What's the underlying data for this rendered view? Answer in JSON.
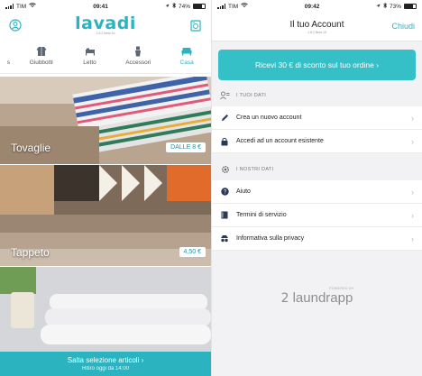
{
  "left": {
    "status": {
      "carrier": "TIM",
      "time": "09:41",
      "battery": "74%"
    },
    "header": {
      "logo_text": "lavadi",
      "logo_sub": "1.8.2 Beta 16",
      "profile_icon": "profile-icon",
      "basket_icon": "basket-icon"
    },
    "categories": [
      {
        "label": "s",
        "icon": "category-icon",
        "partial": true
      },
      {
        "label": "Giubbotti",
        "icon": "jacket-icon"
      },
      {
        "label": "Letto",
        "icon": "bed-icon"
      },
      {
        "label": "Accessori",
        "icon": "accessories-icon"
      },
      {
        "label": "Casa",
        "icon": "sofa-icon",
        "active": true
      }
    ],
    "tiles": [
      {
        "label": "Tovaglie",
        "price": "DALLE 8 €"
      },
      {
        "label": "Tappeto",
        "price": "4,50 €"
      },
      {
        "label": ""
      }
    ],
    "cta": {
      "label": "Salta selezione articoli ›",
      "sub": "Ritiro oggi da 14:00"
    },
    "colors": {
      "accent": "#2bb3c0"
    }
  },
  "right": {
    "status": {
      "carrier": "TIM",
      "time": "09:42",
      "battery": "73%"
    },
    "nav": {
      "title": "Il tuo Account",
      "subtitle": "1.8.2 Beta 16",
      "close": "Chiudi"
    },
    "promo": "Ricevi 30 € di sconto sul tuo ordine ›",
    "sections": [
      {
        "title": "I TUOI DATI",
        "icon": "user-data-icon",
        "rows": [
          {
            "label": "Crea un nuovo account",
            "icon": "pencil-icon"
          },
          {
            "label": "Accedi ad un account esistente",
            "icon": "lock-icon"
          }
        ]
      },
      {
        "title": "I NOSTRI DATI",
        "icon": "gear-icon",
        "rows": [
          {
            "label": "Aiuto",
            "icon": "help-icon"
          },
          {
            "label": "Termini di servizio",
            "icon": "book-icon"
          },
          {
            "label": "Informativa sulla privacy",
            "icon": "privacy-icon"
          }
        ]
      }
    ],
    "brand": {
      "powered": "POWERED BY",
      "name": "laundrapp"
    },
    "colors": {
      "accent": "#2bb3c0",
      "promo": "#35c0c7"
    }
  }
}
